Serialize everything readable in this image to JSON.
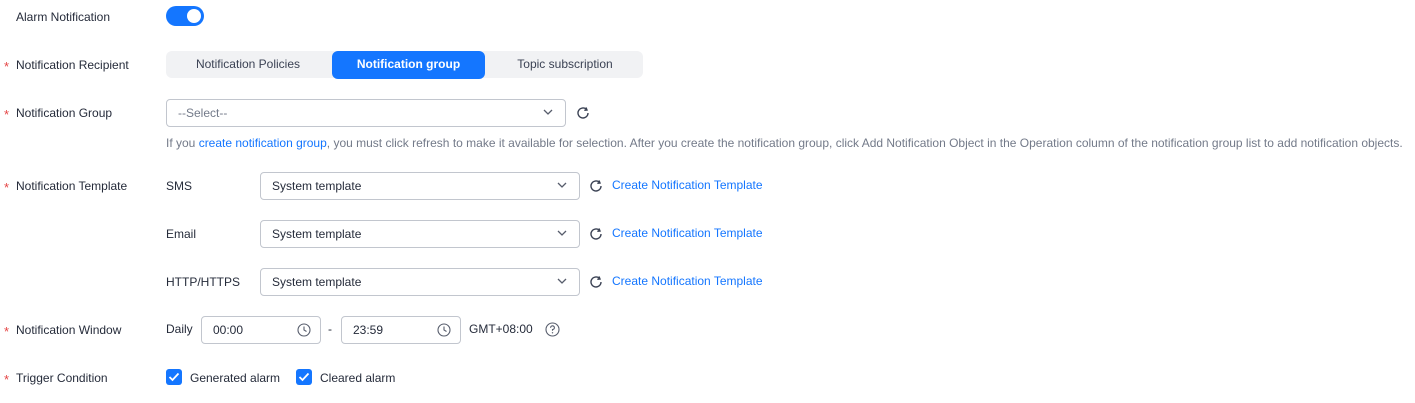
{
  "alarm_notification": {
    "label": "Alarm Notification",
    "enabled": true
  },
  "recipient": {
    "label": "Notification Recipient",
    "options": [
      "Notification Policies",
      "Notification group",
      "Topic subscription"
    ],
    "selected": "Notification group"
  },
  "group": {
    "label": "Notification Group",
    "placeholder": "--Select--",
    "hint_before": "If you ",
    "hint_link": "create notification group",
    "hint_after": ", you must click refresh to make it available for selection. After you create the notification group, click Add Notification Object in the Operation column of the notification group list to add notification objects."
  },
  "template": {
    "label": "Notification Template",
    "rows": [
      {
        "channel": "SMS",
        "value": "System template",
        "link": "Create Notification Template"
      },
      {
        "channel": "Email",
        "value": "System template",
        "link": "Create Notification Template"
      },
      {
        "channel": "HTTP/HTTPS",
        "value": "System template",
        "link": "Create Notification Template"
      }
    ]
  },
  "window": {
    "label": "Notification Window",
    "prefix": "Daily",
    "start": "00:00",
    "separator": "-",
    "end": "23:59",
    "timezone": "GMT+08:00"
  },
  "trigger": {
    "label": "Trigger Condition",
    "options": [
      {
        "label": "Generated alarm",
        "checked": true
      },
      {
        "label": "Cleared alarm",
        "checked": true
      }
    ]
  },
  "colors": {
    "accent": "#1476ff",
    "required": "#e54545",
    "hint": "#737a89"
  },
  "icons": [
    "refresh-icon",
    "chevron-down-icon",
    "clock-icon",
    "help-icon",
    "check-icon"
  ]
}
